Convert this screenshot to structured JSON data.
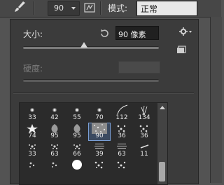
{
  "toolbar": {
    "brush_size": "90",
    "mode_label": "模式:",
    "mode_value": "正常"
  },
  "panel": {
    "size_label": "大小:",
    "size_value": "90 像素",
    "size_fraction": 0.45,
    "hardness_label": "硬度:"
  },
  "brushes": [
    {
      "label": "33",
      "icon": "dot-small-icon"
    },
    {
      "label": "42",
      "icon": "dot-small-icon"
    },
    {
      "label": "55",
      "icon": "dot-small-icon"
    },
    {
      "label": "70",
      "icon": "dot-small-icon"
    },
    {
      "label": "112",
      "icon": "curved-stroke-icon"
    },
    {
      "label": "134",
      "icon": "grass-stroke-icon"
    },
    {
      "label": "74",
      "icon": "star-leaf-icon"
    },
    {
      "label": "95",
      "icon": "leaf-icon"
    },
    {
      "label": "95",
      "icon": "leaf-icon"
    },
    {
      "label": "90",
      "icon": "texture-square-icon"
    },
    {
      "label": "36",
      "icon": "scatter-icon"
    },
    {
      "label": "36",
      "icon": "scatter-icon"
    },
    {
      "label": "33",
      "icon": "splatter-icon"
    },
    {
      "label": "63",
      "icon": "splatter-icon"
    },
    {
      "label": "66",
      "icon": "splatter-icon"
    },
    {
      "label": "39",
      "icon": "dry-brush-icon"
    },
    {
      "label": "63",
      "icon": "dry-brush-icon"
    },
    {
      "label": "11",
      "icon": "stroke-small-icon"
    },
    {
      "label": "",
      "icon": "chalk-icon"
    },
    {
      "label": "",
      "icon": "chalk-icon"
    },
    {
      "label": "",
      "icon": "round-hard-icon"
    },
    {
      "label": "",
      "icon": "scatter-icon"
    },
    {
      "label": "",
      "icon": "scatter-icon"
    },
    {
      "label": "",
      "icon": "blank"
    }
  ],
  "selected_brush_index": 9
}
